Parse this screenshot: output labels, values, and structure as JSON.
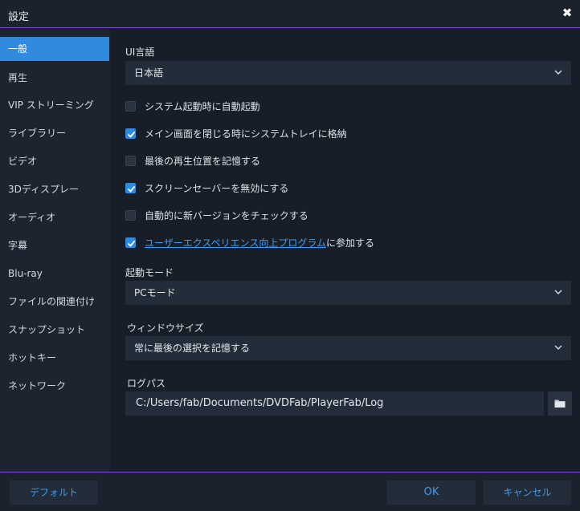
{
  "window": {
    "title": "設定",
    "close_glyph": "✖"
  },
  "sidebar": {
    "items": [
      {
        "label": "一般",
        "active": true
      },
      {
        "label": "再生"
      },
      {
        "label": "VIP ストリーミング"
      },
      {
        "label": "ライブラリー"
      },
      {
        "label": "ビデオ"
      },
      {
        "label": "3Dディスプレー"
      },
      {
        "label": "オーディオ"
      },
      {
        "label": "字幕"
      },
      {
        "label": "Blu-ray"
      },
      {
        "label": "ファイルの関連付け"
      },
      {
        "label": "スナップショット"
      },
      {
        "label": "ホットキー"
      },
      {
        "label": "ネットワーク"
      }
    ]
  },
  "general": {
    "ui_language": {
      "label": "UI言語",
      "value": "日本語"
    },
    "options": [
      {
        "label": "システム起動時に自動起動",
        "checked": false
      },
      {
        "label": "メイン画面を閉じる時にシステムトレイに格納",
        "checked": true
      },
      {
        "label": "最後の再生位置を記憶する",
        "checked": false
      },
      {
        "label": "スクリーンセーバーを無効にする",
        "checked": true
      },
      {
        "label": "自動的に新バージョンをチェックする",
        "checked": false
      },
      {
        "label_link": "ユーザーエクスペリエンス向上プログラム",
        "label_suffix": "に参加する",
        "checked": true
      }
    ],
    "startup_mode": {
      "label": "起動モード",
      "value": "PCモード"
    },
    "window_size": {
      "label": "ウィンドウサイズ",
      "value": "常に最後の選択を記憶する"
    },
    "log_path": {
      "label": "ログパス",
      "value": "C:/Users/fab/Documents/DVDFab/PlayerFab/Log"
    }
  },
  "footer": {
    "default_label": "デフォルト",
    "ok_label": "OK",
    "cancel_label": "キャンセル"
  },
  "colors": {
    "accent": "#2f8ae0",
    "link": "#3d9cf0",
    "divider": "#7b4fd6"
  }
}
